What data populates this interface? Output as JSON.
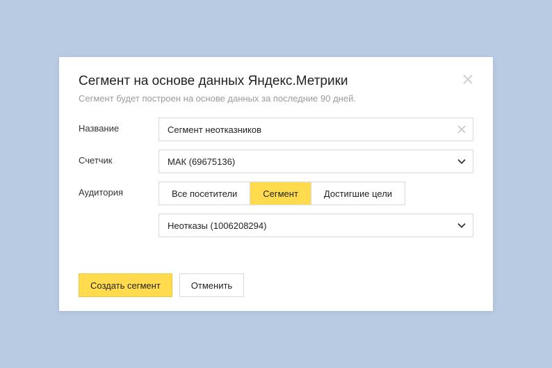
{
  "modal": {
    "title": "Сегмент на основе данных Яндекс.Метрики",
    "subtitle": "Сегмент будет построен на основе данных за последние 90 дней."
  },
  "fields": {
    "name_label": "Название",
    "name_value": "Сегмент неотказников",
    "counter_label": "Счетчик",
    "counter_value": "МАК (69675136)",
    "audience_label": "Аудитория",
    "audience_options": {
      "all": "Все посетители",
      "segment": "Сегмент",
      "goal": "Достигшие цели"
    },
    "segment_value": "Неотказы (1006208294)"
  },
  "footer": {
    "create": "Создать сегмент",
    "cancel": "Отменить"
  }
}
